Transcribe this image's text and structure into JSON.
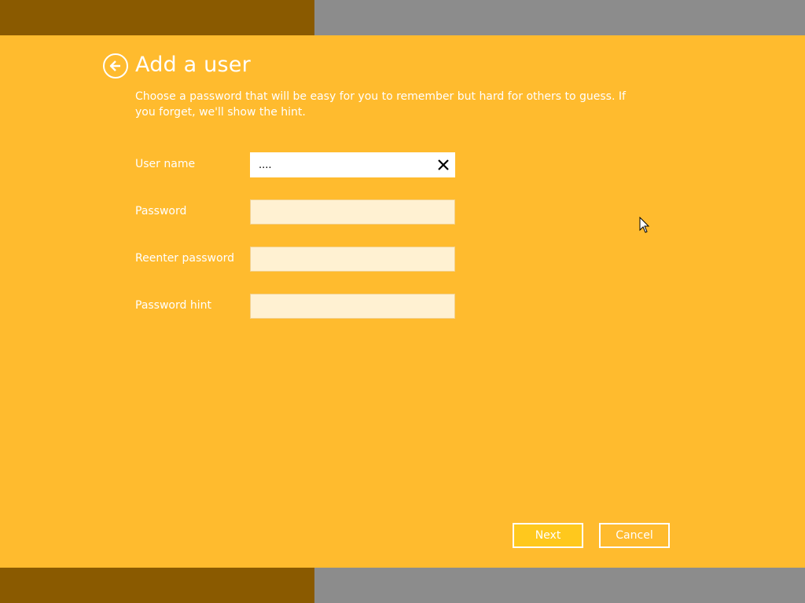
{
  "dialog": {
    "title": "Add a user",
    "description": "Choose a password that will be easy for you to remember but hard for others to guess. If you forget, we'll show the hint."
  },
  "fields": {
    "user_name": {
      "label": "User name",
      "value": "...."
    },
    "password": {
      "label": "Password",
      "value": ""
    },
    "reenter_password": {
      "label": "Reenter password",
      "value": ""
    },
    "password_hint": {
      "label": "Password hint",
      "value": ""
    }
  },
  "buttons": {
    "next": "Next",
    "cancel": "Cancel"
  },
  "icons": {
    "back": "back-arrow-icon",
    "clear": "close-icon",
    "pointer": "mouse-pointer-icon"
  },
  "colors": {
    "accent": "#ffbb2e",
    "band_left": "#8a5a00",
    "band_right": "#8c8c8c"
  }
}
